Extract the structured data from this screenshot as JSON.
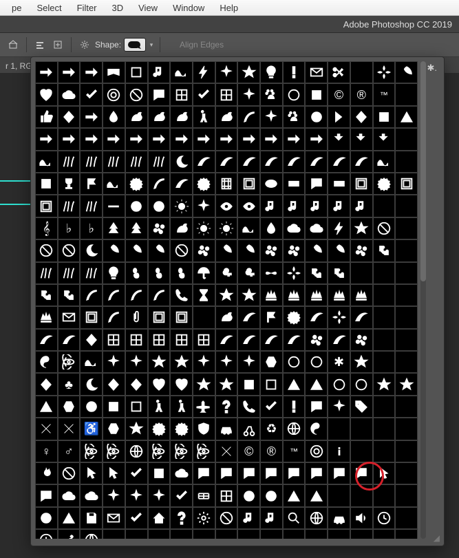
{
  "mac_menu": {
    "items": [
      "pe",
      "Select",
      "Filter",
      "3D",
      "View",
      "Window",
      "Help"
    ]
  },
  "app_title": "Adobe Photoshop CC 2019",
  "options": {
    "shape_label": "Shape:",
    "align_edges": "Align Edges"
  },
  "doc_tab": "r 1, RG",
  "panel": {
    "rows": 21,
    "cols": 17,
    "highlight_index": 320,
    "shapes": [
      "arrow-thin-right",
      "arrow-right",
      "arrow-block-right",
      "banner",
      "square-outline",
      "music-note",
      "wave",
      "lightning",
      "sparkle",
      "star",
      "lightbulb",
      "exclaim",
      "envelope",
      "scissors",
      "",
      "fleur",
      "leaf-3",
      "heart",
      "blob",
      "check",
      "target",
      "no-sign",
      "speech",
      "grid-diag",
      "checker",
      "grid",
      "burst-8",
      "paw",
      "ring",
      "square",
      "copyright",
      "registered",
      "trademark",
      "",
      "thumb-up",
      "diamond",
      "arrow-3d",
      "drop",
      "cat",
      "dog",
      "snail",
      "run-man",
      "bird",
      "feather",
      "burst",
      "paw2",
      "circle",
      "chevron",
      "lozenge",
      "square-solid",
      "triangle",
      "arrow-thin",
      "arrow-double",
      "arrow-med",
      "arrow-open",
      "arrow-fat",
      "arrow-solid",
      "arrow-head",
      "arrow-wide",
      "arrow-shadow",
      "arrow-line",
      "arrow-dash",
      "arrow-point",
      "arrow-feather",
      "u-turn",
      "back",
      "redo",
      "",
      "waves",
      "grass",
      "scribble",
      "sketch",
      "scribble2",
      "hatch",
      "moon",
      "swoosh",
      "swoosh2",
      "swoosh3",
      "swoosh4",
      "corner",
      "ribbon",
      "curl",
      "ribbon2",
      "wave2",
      "",
      "square2",
      "trophy",
      "flag",
      "flag-wave",
      "seal",
      "seal-open",
      "ribbon3",
      "award",
      "film",
      "frame",
      "oval",
      "rect",
      "speech2",
      "rect-round",
      "frame2",
      "seal2",
      "frame3",
      "stamp",
      "lines",
      "dots",
      "bar",
      "circle-dash",
      "circle-dots",
      "sun-rays",
      "ray-burst",
      "eye",
      "eye2",
      "note",
      "note2",
      "note3",
      "treble",
      "bass",
      "",
      "",
      "treble2",
      "flat",
      "natural",
      "tree",
      "fern",
      "flower",
      "butterfly",
      "sun",
      "sun2",
      "wave3",
      "drop2",
      "cloud",
      "cloud2",
      "bolt",
      "star-4",
      "snow",
      "",
      "snow2",
      "snow3",
      "moon2",
      "leaf",
      "leaf2",
      "leaf3",
      "snow4",
      "flower2",
      "maple",
      "leaf4",
      "flower3",
      "flower4",
      "clover",
      "clover2",
      "flower5",
      "puzzle",
      "",
      "grass2",
      "grass3",
      "grass4",
      "bulb",
      "foot-r",
      "foot-l",
      "foot",
      "umbrella",
      "key",
      "key2",
      "bow",
      "fleur2",
      "puzzle2",
      "puzzle3",
      "",
      "",
      "",
      "puzzle4",
      "puzzle5",
      "pencil",
      "pencil2",
      "pencil3",
      "pencil4",
      "phone",
      "hourglass",
      "star-badge",
      "star-badge2",
      "crown",
      "crown2",
      "crown3",
      "crown4",
      "chess",
      "",
      "",
      "chess-k",
      "mail",
      "stamp2",
      "pen",
      "clip",
      "stamp3",
      "stamp4",
      "",
      "butterfly2",
      "curl2",
      "flag-us",
      "seal3",
      "orn",
      "fleur3",
      "orn2",
      "",
      "",
      "frame-orn",
      "frame-orn2",
      "diamond2",
      "tile",
      "tile2",
      "flower-tile",
      "tile3",
      "tile4",
      "orn3",
      "vine",
      "vine2",
      "vine3",
      "flower6",
      "vine4",
      "flower7",
      "",
      "",
      "yin",
      "atom",
      "wave4",
      "burst2",
      "burst3",
      "star-out",
      "star5",
      "splat",
      "splat2",
      "burst4",
      "hex",
      "ring2",
      "ring3",
      "asterisk",
      "star-thin",
      "",
      "",
      "diamond3",
      "club",
      "moon3",
      "diamond4",
      "diamond5",
      "heart2",
      "heart-out",
      "star-8",
      "star-8b",
      "square3",
      "square-out",
      "tri",
      "tri-out",
      "circle2",
      "circle-out",
      "star6",
      "star-out2",
      "tri2",
      "hex2",
      "circle3",
      "square4",
      "square-out2",
      "man",
      "woman",
      "plane",
      "question",
      "phone2",
      "check2",
      "exclaim2",
      "speech3",
      "burst5",
      "tag",
      "",
      "",
      "x",
      "x-round",
      "wheelchair",
      "octagon",
      "star7",
      "seal4",
      "badge",
      "shield",
      "car",
      "bike",
      "recycle",
      "earth",
      "yin2",
      "",
      "",
      "",
      "",
      "female",
      "male",
      "atom2",
      "atom3",
      "globe",
      "radiation",
      "biohazard",
      "caduceus",
      "rx",
      "copyright2",
      "registered2",
      "tm",
      "target2",
      "info",
      "",
      "",
      "",
      "fire",
      "no",
      "pointer",
      "pointer2",
      "check-box",
      "square5",
      "thought",
      "speech4",
      "speech5",
      "speech6",
      "speech7",
      "speech8",
      "speech9",
      "speech-round",
      "speech-highlight",
      "hand",
      "",
      "speech10",
      "thought2",
      "thought3",
      "burst6",
      "burst7",
      "burst8",
      "checker2",
      "greek",
      "grid2",
      "plus-circle",
      "minus-circle",
      "tri-left",
      "tri-right",
      "",
      "",
      "",
      "",
      "down-circle",
      "up-tri",
      "save",
      "mail2",
      "check3",
      "home",
      "help",
      "gear",
      "no2",
      "music",
      "music2",
      "search",
      "globe2",
      "cart",
      "sound",
      "time",
      "",
      "clock",
      "tools",
      "globe3",
      "",
      "",
      "",
      "",
      "",
      "",
      "",
      "",
      "",
      "",
      "",
      "",
      "",
      ""
    ]
  }
}
